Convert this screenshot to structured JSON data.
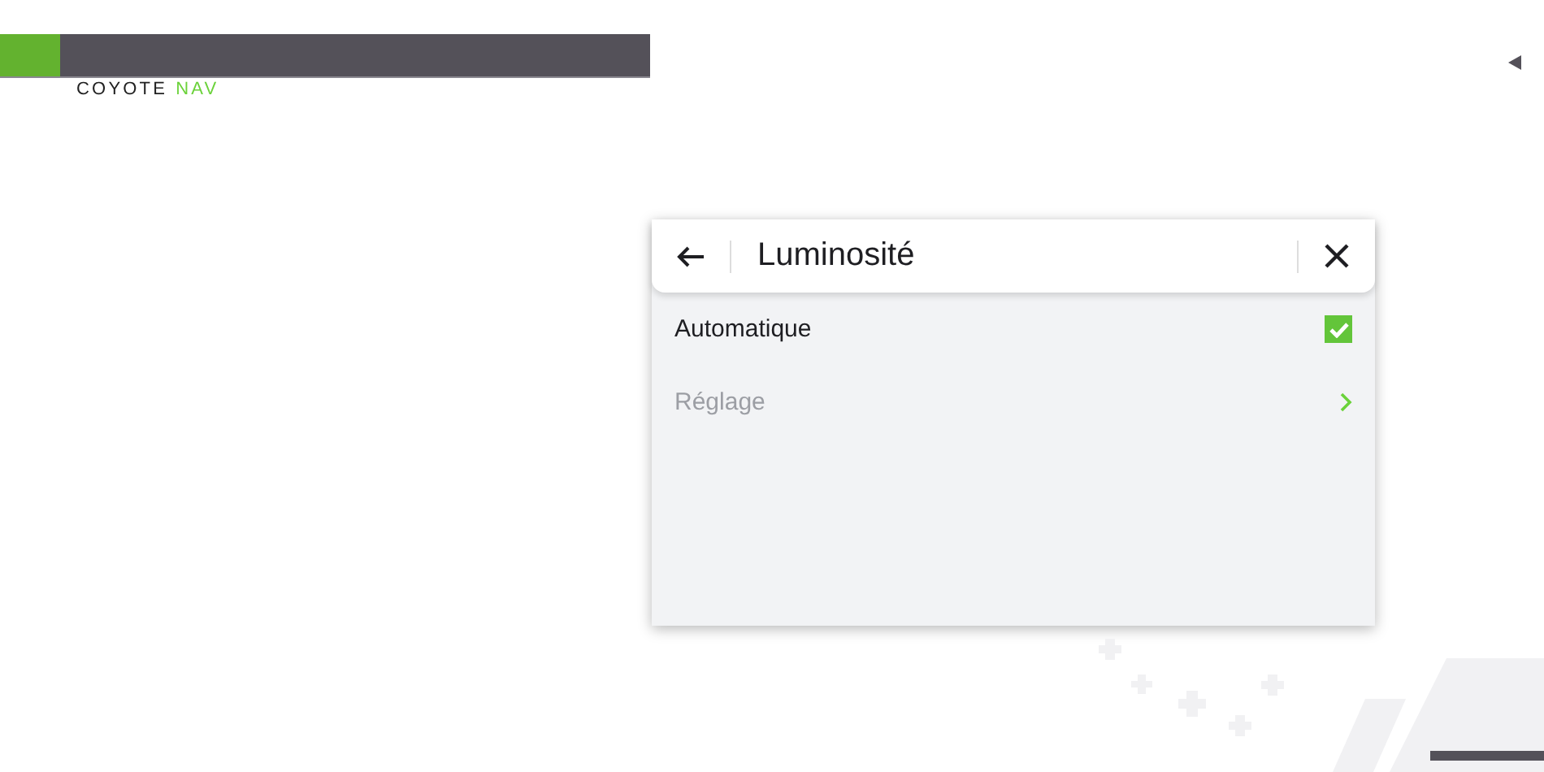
{
  "logo": {
    "brand": "COYOTE",
    "accent": "NAV"
  },
  "dialog": {
    "title": "Luminosité",
    "rows": [
      {
        "kind": "checkbox",
        "label": "Automatique",
        "checked": true,
        "disabled": false
      },
      {
        "kind": "link",
        "label": "Réglage",
        "disabled": true
      }
    ]
  }
}
